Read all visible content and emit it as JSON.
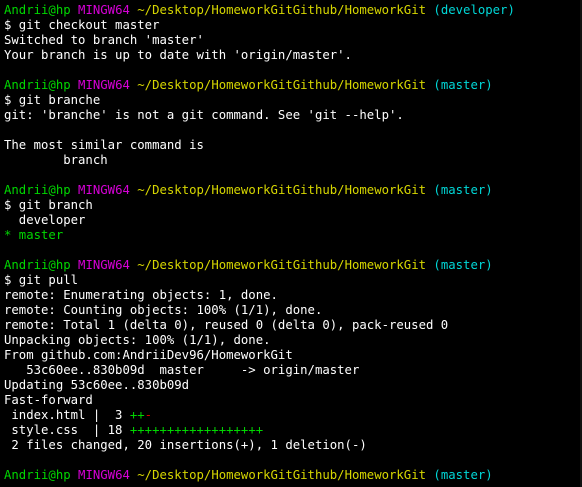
{
  "terminal": {
    "colors": {
      "background": "#000000",
      "text": "#ffffff",
      "user": "#00d700",
      "host": "#d700d7",
      "path": "#d7d700",
      "branch": "#00d7d7",
      "plus": "#00d700",
      "minus": "#d70000"
    },
    "user_host": "Andrii@hp",
    "shell": "MINGW64",
    "path": "~/Desktop/HomeworkGitGithub/HomeworkGit",
    "blocks": [
      {
        "branch": "(developer)",
        "command": "$ git checkout master",
        "output": [
          "Switched to branch 'master'",
          "Your branch is up to date with 'origin/master'."
        ]
      },
      {
        "branch": "(master)",
        "command": "$ git branche",
        "output": [
          "git: 'branche' is not a git command. See 'git --help'.",
          "",
          "The most similar command is",
          "        branch"
        ]
      },
      {
        "branch": "(master)",
        "command": "$ git branch",
        "output": [
          "  developer"
        ],
        "current_branch": "* master"
      },
      {
        "branch": "(master)",
        "command": "$ git pull",
        "output": [
          "remote: Enumerating objects: 1, done.",
          "remote: Counting objects: 100% (1/1), done.",
          "remote: Total 1 (delta 0), reused 0 (delta 0), pack-reused 0",
          "Unpacking objects: 100% (1/1), done.",
          "From github.com:AndriiDev96/HomeworkGit",
          "   53c60ee..830b09d  master     -> origin/master",
          "Updating 53c60ee..830b09d",
          "Fast-forward"
        ],
        "diffstat": [
          {
            "name": " index.html |  3 ",
            "plus": "++",
            "minus": "-"
          },
          {
            "name": " style.css  | 18 ",
            "plus": "++++++++++++++++++",
            "minus": ""
          }
        ],
        "summary": " 2 files changed, 20 insertions(+), 1 deletion(-)"
      },
      {
        "branch": "(master)",
        "command": "",
        "output": []
      }
    ]
  }
}
